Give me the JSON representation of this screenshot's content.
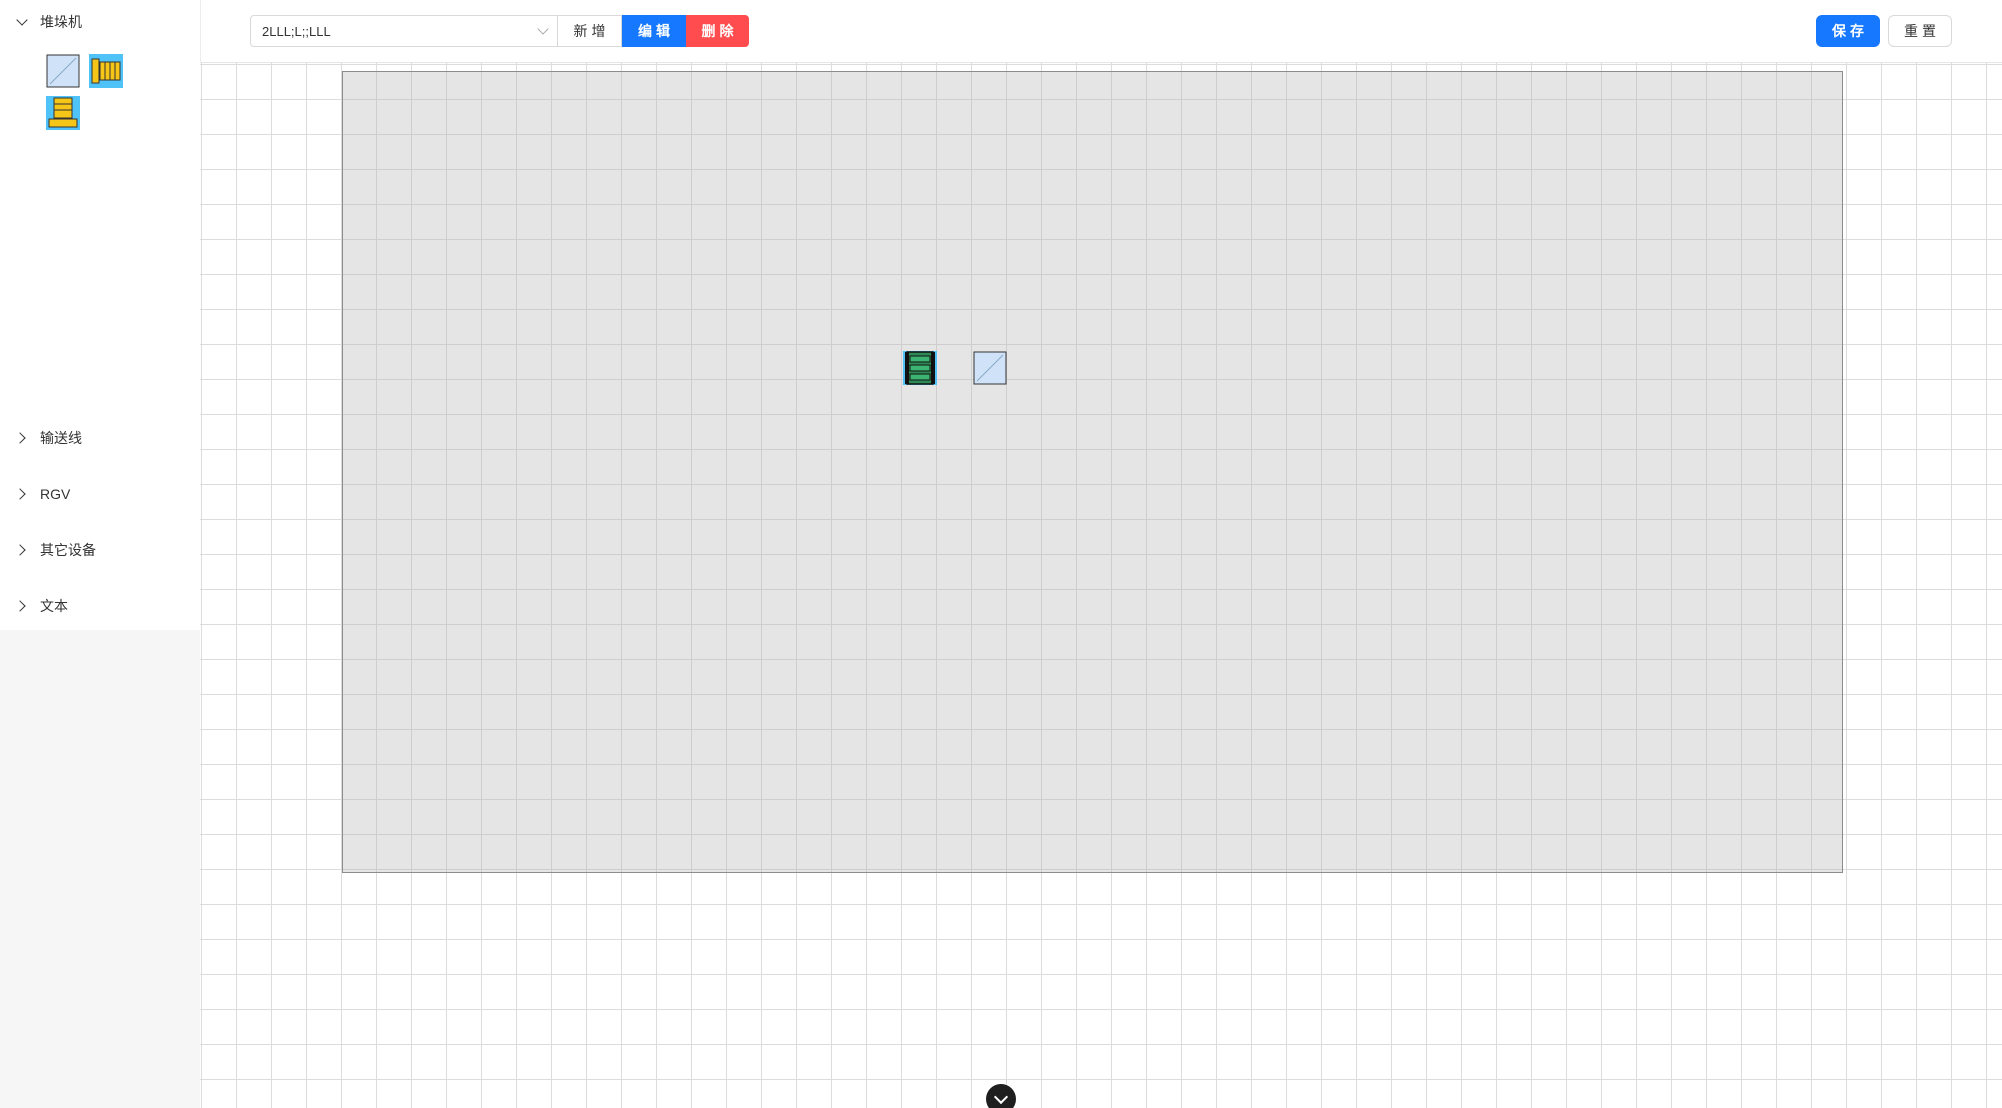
{
  "sidebar": {
    "categories": [
      {
        "label": "堆垛机",
        "expanded": true
      },
      {
        "label": "输送线",
        "expanded": false
      },
      {
        "label": "RGV",
        "expanded": false
      },
      {
        "label": "其它设备",
        "expanded": false
      },
      {
        "label": "文本",
        "expanded": false
      }
    ],
    "palette_items": [
      {
        "icon": "stacker-placeholder-icon"
      },
      {
        "icon": "stacker-crane-vertical-icon"
      },
      {
        "icon": "stacker-crane-base-icon"
      }
    ]
  },
  "toolbar": {
    "layout_select_value": "2LLL;L;;LLL",
    "add_label": "新增",
    "edit_label": "编辑",
    "delete_label": "删除",
    "save_label": "保存",
    "reset_label": "重置"
  },
  "canvas": {
    "placed_devices": [
      {
        "icon": "green-stacker-crane-icon"
      },
      {
        "icon": "blank-device-icon"
      }
    ]
  },
  "colors": {
    "primary": "#1677ff",
    "danger": "#ff4d4f",
    "device_yellow": "#f5c518",
    "device_cyan": "#4fc3f7",
    "device_green": "#2e8b57",
    "placeholder_blue": "#cfe2f7"
  }
}
